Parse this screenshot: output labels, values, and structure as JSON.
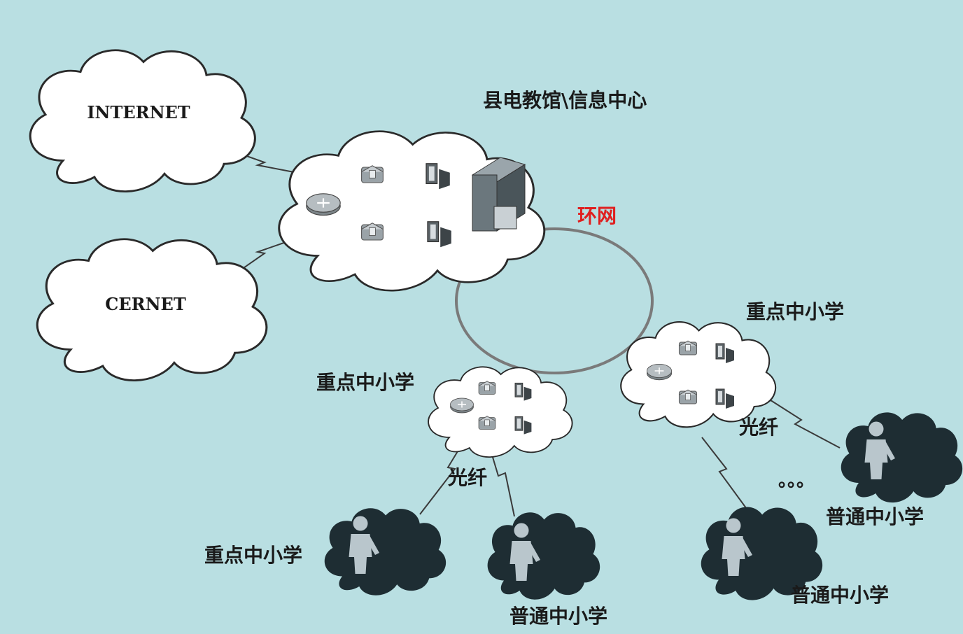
{
  "diagram": {
    "center_title": "县电教馆\\信息中心",
    "ring_label": "环网",
    "internet_label": "INTERNET",
    "cernet_label": "CERNET",
    "key_school_left": "重点中小学",
    "key_school_right": "重点中小学",
    "fiber_left": "光纤",
    "fiber_right": "光纤",
    "key_school_bottom": "重点中小学",
    "normal_school_bottom": "普通中小学",
    "normal_school_right_a": "普通中小学",
    "normal_school_right_b": "普通中小学",
    "ellipsis": "。。。",
    "colors": {
      "background": "#b9dfe2",
      "ring": "#7a7a7a",
      "ring_label": "#e01f1f",
      "dark_cloud": "#1e2d33",
      "text": "#1a1a1a"
    }
  }
}
